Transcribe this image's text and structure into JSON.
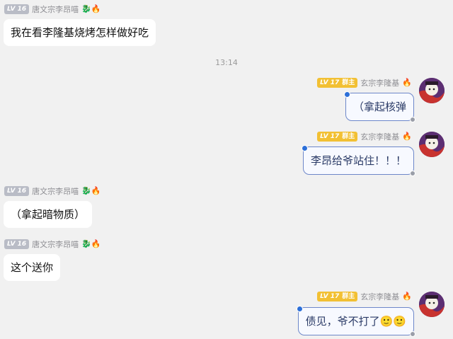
{
  "timestamp": "13:14",
  "messages": [
    {
      "level": "LV 16",
      "sender": "唐文宗李昂喵",
      "emoji": "🐉🔥",
      "text": "我在看李隆基烧烤怎样做好吃"
    },
    {
      "level": "LV 17",
      "role": "群主",
      "sender": "玄宗李隆基",
      "emoji": "🔥",
      "text": "（拿起核弹"
    },
    {
      "level": "LV 17",
      "role": "群主",
      "sender": "玄宗李隆基",
      "emoji": "🔥",
      "text": "李昂给爷站住！！！"
    },
    {
      "level": "LV 16",
      "sender": "唐文宗李昂喵",
      "emoji": "🐉🔥",
      "text": "（拿起暗物质）"
    },
    {
      "level": "LV 16",
      "sender": "唐文宗李昂喵",
      "emoji": "🐉🔥",
      "text": "这个送你"
    },
    {
      "level": "LV 17",
      "role": "群主",
      "sender": "玄宗李隆基",
      "emoji": "🔥",
      "text": "债见，爷不打了🙂🙂"
    }
  ]
}
